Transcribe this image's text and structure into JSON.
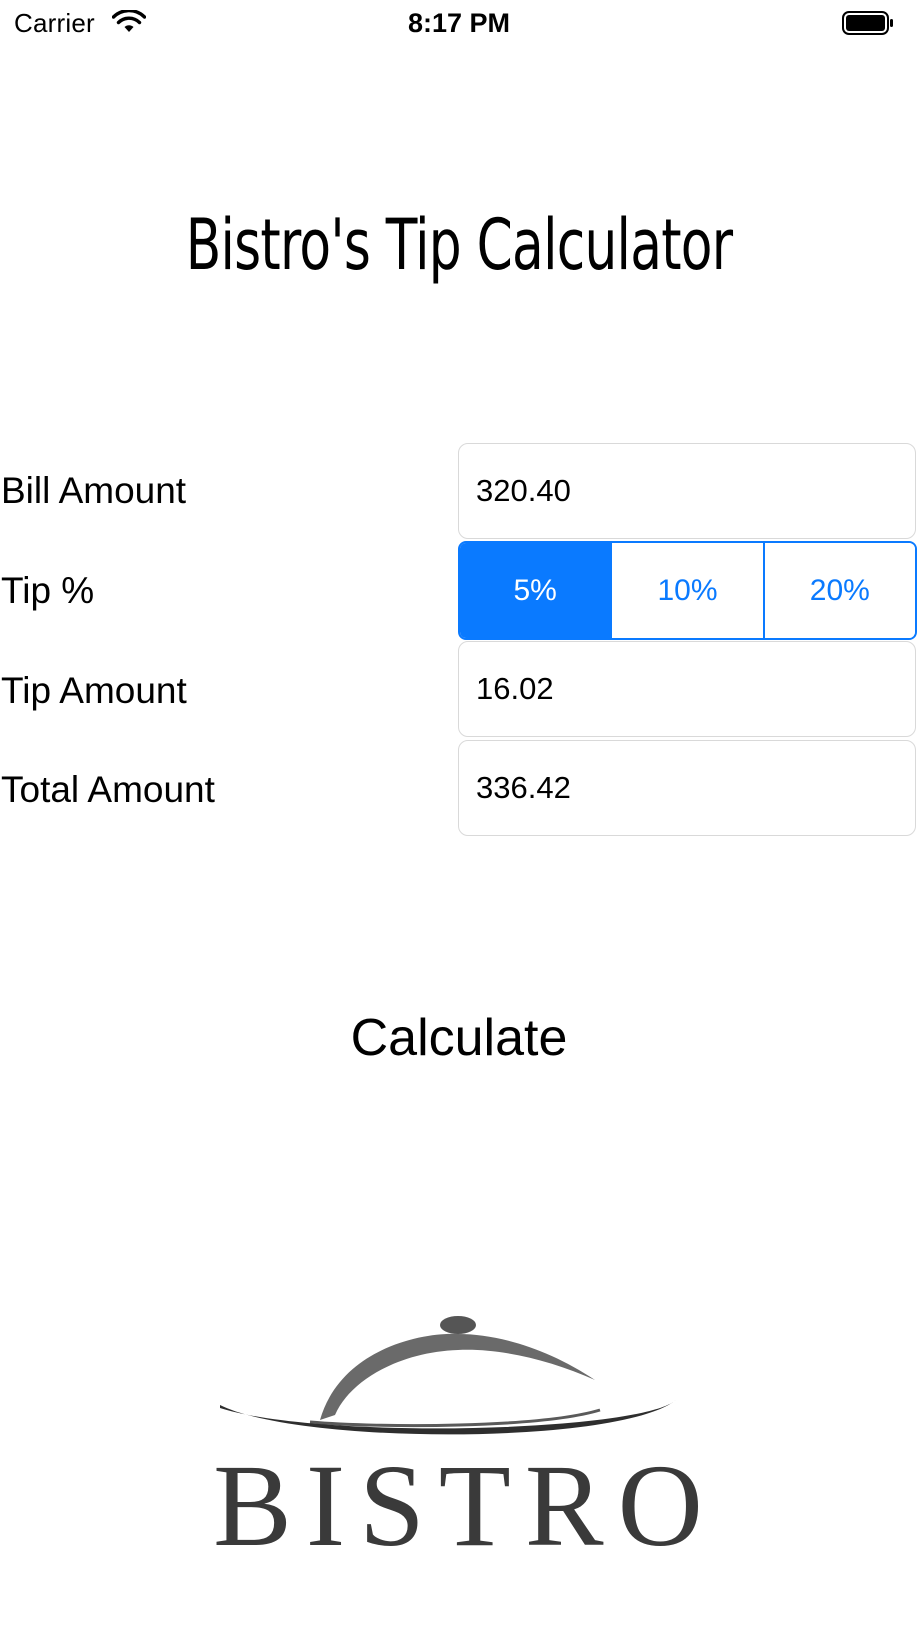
{
  "status_bar": {
    "carrier": "Carrier",
    "time": "8:17 PM",
    "wifi_icon": "wifi-icon",
    "battery_icon": "battery-icon"
  },
  "app": {
    "title": "Bistro's Tip Calculator"
  },
  "form": {
    "bill_label": "Bill Amount",
    "bill_value": "320.40",
    "tip_label": "Tip %",
    "tip_options": [
      "5%",
      "10%",
      "20%"
    ],
    "tip_selected": "5%",
    "tip_amount_label": "Tip Amount",
    "tip_amount_value": "16.02",
    "total_label": "Total Amount",
    "total_value": "336.42"
  },
  "actions": {
    "calculate_label": "Calculate"
  },
  "logo": {
    "text": "BISTRO",
    "icon": "cloche-icon"
  },
  "colors": {
    "accent": "#0a7aff",
    "field_border": "#d9d9d9",
    "logo_gray": "#3a3a3a"
  }
}
